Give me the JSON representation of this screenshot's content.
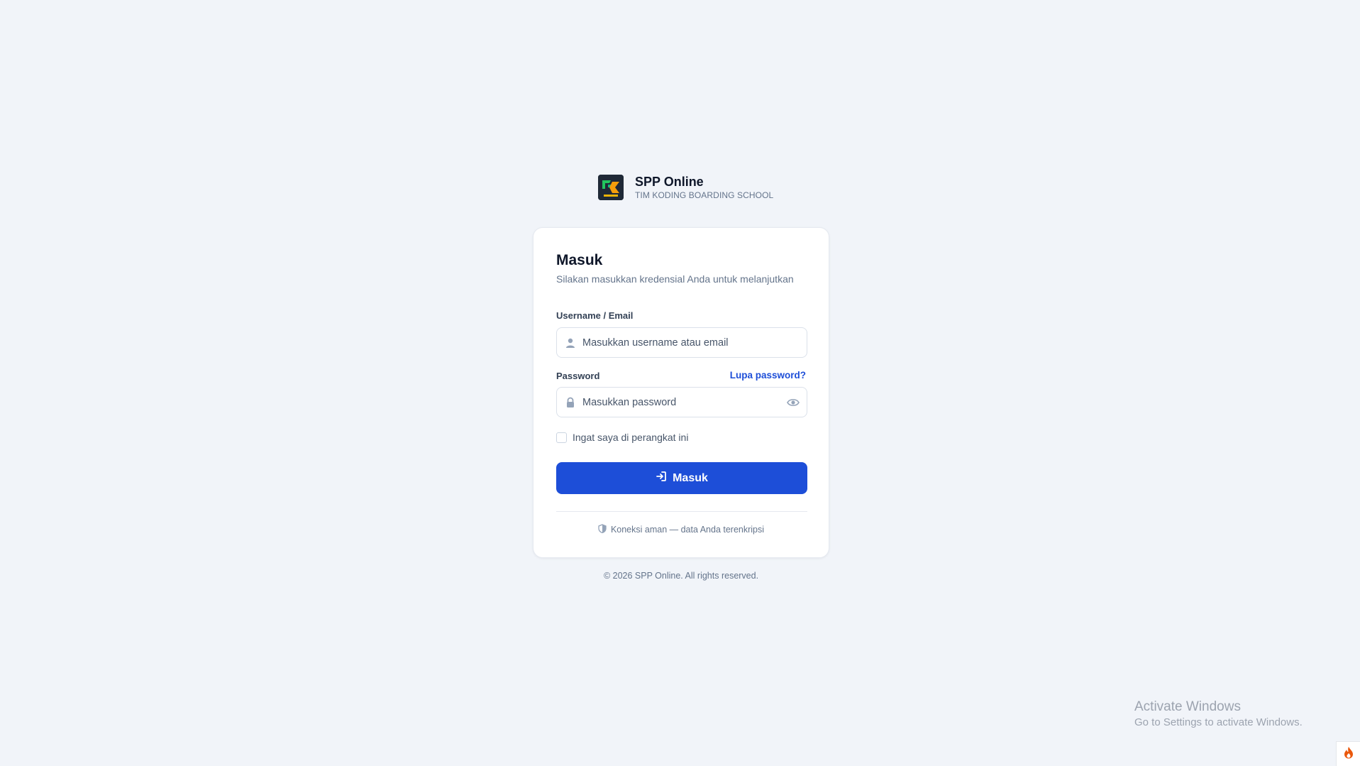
{
  "brand": {
    "title": "SPP Online",
    "subtitle": "TIM KODING BOARDING SCHOOL",
    "logo_icon": "school-logo-icon"
  },
  "login": {
    "title": "Masuk",
    "subtitle": "Silakan masukkan kredensial Anda untuk melanjutkan",
    "username_label": "Username / Email",
    "username_placeholder": "Masukkan username atau email",
    "username_value": "",
    "password_label": "Password",
    "forgot_label": "Lupa password?",
    "password_placeholder": "Masukkan password",
    "password_value": "",
    "remember_label": "Ingat saya di perangkat ini",
    "remember_checked": false,
    "submit_label": "Masuk",
    "secure_note": "Koneksi aman — data Anda terenkripsi"
  },
  "footer": {
    "copyright": "© 2026 SPP Online. All rights reserved."
  },
  "system": {
    "activate_title": "Activate Windows",
    "activate_sub": "Go to Settings to activate Windows."
  },
  "colors": {
    "background": "#f1f4f9",
    "primary": "#1d4ed8",
    "text": "#0f172a",
    "muted": "#64748b"
  }
}
